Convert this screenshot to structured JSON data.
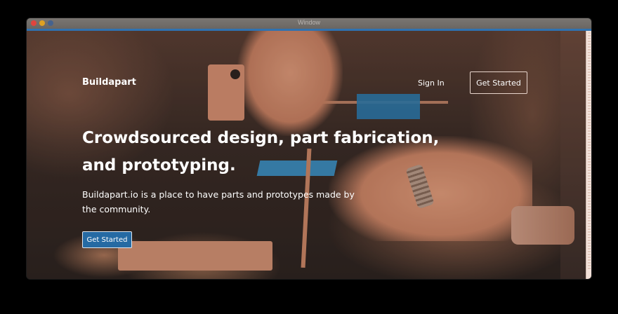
{
  "window": {
    "title": "Window"
  },
  "nav": {
    "brand": "Buildapart",
    "sign_in": "Sign In",
    "get_started": "Get Started"
  },
  "hero": {
    "headline": "Crowdsourced design, part fabrication, and prototyping.",
    "subtext": "Buildapart.io is a place to have parts and prototypes made by the community.",
    "cta": "Get Started",
    "background": "workshop-photo"
  },
  "colors": {
    "accent": "#256aa3",
    "top_strip": "#2f72b1",
    "text": "#ffffff"
  }
}
